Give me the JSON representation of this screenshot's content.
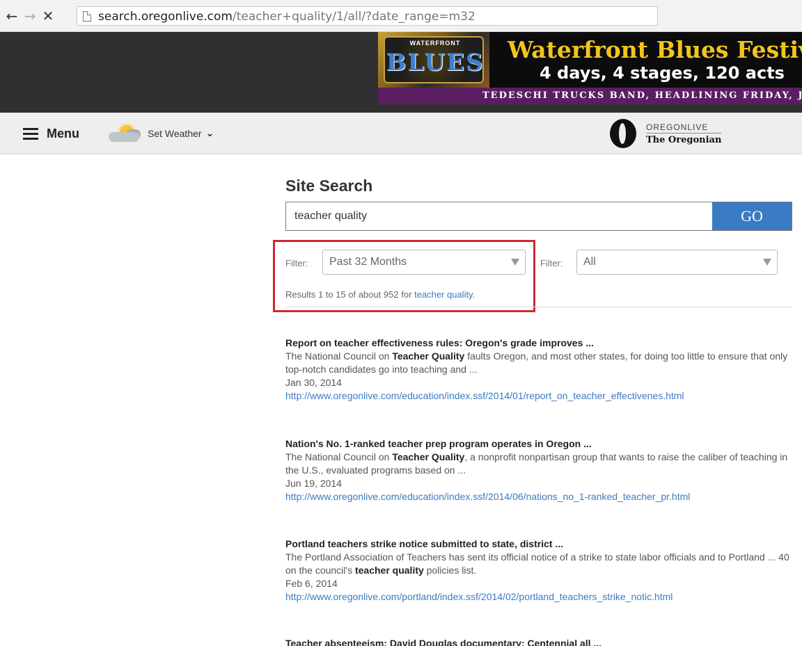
{
  "browser": {
    "url_host": "search.oregonlive.com",
    "url_path": "/teacher+quality/1/all/?date_range=m32",
    "back_icon": "arrow-left-icon",
    "forward_icon": "arrow-right-icon",
    "stop_icon": "close-icon"
  },
  "ad": {
    "logo_top": "WATERFRONT",
    "logo_text": "BLUES",
    "title": "Waterfront Blues Festiva",
    "subtitle": "4 days, 4 stages, 120 acts",
    "strip": "TEDESCHI TRUCKS BAND, HEADLINING FRIDAY, JU"
  },
  "header": {
    "menu_label": "Menu",
    "weather_label": "Set Weather",
    "brand_top": "OREGONLIVE",
    "brand_bottom": "The Oregonian"
  },
  "search": {
    "title": "Site Search",
    "query": "teacher quality",
    "go_label": "GO",
    "filter1_label": "Filter:",
    "filter1_value": "Past 32 Months",
    "filter2_label": "Filter:",
    "filter2_value": "All",
    "results_prefix": "Results 1 to 15 of about 952 for ",
    "results_query": "teacher quality",
    "results_suffix": "."
  },
  "results": [
    {
      "title": "Report on teacher effectiveness rules: Oregon's grade improves ...",
      "snippet_pre": "The National Council on ",
      "snippet_bold": "Teacher Quality",
      "snippet_post": " faults Oregon, and most other states, for doing too little to ensure that only top-notch candidates go into teaching and ...",
      "date": "Jan 30, 2014",
      "url": "http://www.oregonlive.com/education/index.ssf/2014/01/report_on_teacher_effectivenes.html"
    },
    {
      "title": "Nation's No. 1-ranked teacher prep program operates in Oregon ...",
      "snippet_pre": "The National Council on ",
      "snippet_bold": "Teacher Quality",
      "snippet_post": ", a nonprofit nonpartisan group that wants to raise the caliber of teaching in the U.S., evaluated programs based on ...",
      "date": "Jun 19, 2014",
      "url": "http://www.oregonlive.com/education/index.ssf/2014/06/nations_no_1-ranked_teacher_pr.html"
    },
    {
      "title": "Portland teachers strike notice submitted to state, district ...",
      "snippet_pre": "The Portland Association of Teachers has sent its official notice of a strike to state labor officials and to Portland ... 40 on the council's ",
      "snippet_bold": "teacher quality",
      "snippet_post": " policies list.",
      "date": "Feb 6, 2014",
      "url": "http://www.oregonlive.com/portland/index.ssf/2014/02/portland_teachers_strike_notic.html"
    },
    {
      "title": "Teacher absenteeism; David Douglas documentary; Centennial all ..."
    }
  ]
}
